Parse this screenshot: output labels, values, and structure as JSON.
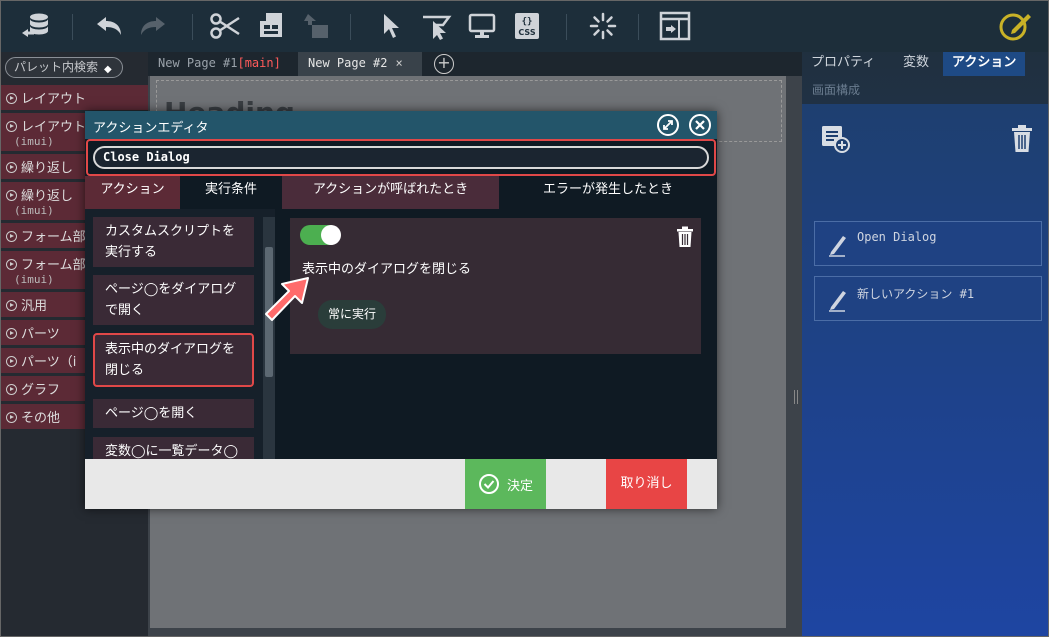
{
  "toolbar": {
    "icons": [
      "database-icon",
      "undo-icon",
      "redo-icon",
      "cut-icon",
      "copy-icon",
      "paste-icon",
      "select-icon",
      "select-parent-icon",
      "preview-icon",
      "css-icon",
      "loading-icon",
      "window-icon",
      "edit-mode-icon"
    ],
    "css_label": "CSS",
    "css_braces": "{}"
  },
  "palette": {
    "search_placeholder": "パレット内検索",
    "items": [
      {
        "label": "レイアウト",
        "sub": ""
      },
      {
        "label": "レイアウト",
        "sub": "(imui)"
      },
      {
        "label": "繰り返し",
        "sub": ""
      },
      {
        "label": "繰り返し",
        "sub": "(imui)"
      },
      {
        "label": "フォーム部",
        "sub": ""
      },
      {
        "label": "フォーム部",
        "sub": "(imui)"
      },
      {
        "label": "汎用",
        "sub": ""
      },
      {
        "label": "パーツ",
        "sub": ""
      },
      {
        "label": "パーツ（i",
        "sub": ""
      },
      {
        "label": "グラフ",
        "sub": ""
      },
      {
        "label": "その他",
        "sub": ""
      }
    ]
  },
  "page_tabs": {
    "tab1": {
      "label": "New Page #1",
      "badge": "[main]"
    },
    "tab2": {
      "label": "New Page #2",
      "close": "×"
    },
    "add": "+"
  },
  "canvas": {
    "heading": "Heading"
  },
  "right_panel": {
    "tabs": [
      "プロパティ",
      "変数",
      "アクション"
    ],
    "active_tab": "アクション",
    "subtitle": "画面構成",
    "actions": [
      "Open Dialog",
      "新しいアクション #1"
    ]
  },
  "dialog": {
    "title": "アクションエディタ",
    "name_value": "Close Dialog",
    "tabs": [
      {
        "label": "アクション",
        "bg": "#5c2a36"
      },
      {
        "label": "実行条件",
        "bg": "#0f1a23"
      },
      {
        "label": "アクションが呼ばれたとき",
        "bg": "#4a2c3a"
      },
      {
        "label": "エラーが発生したとき",
        "bg": "#0f1a23"
      }
    ],
    "action_list": [
      {
        "line1": "カスタムスクリプトを",
        "line2": "実行する"
      },
      {
        "line1": "ページ◯をダイアログ",
        "line2": "で開く"
      },
      {
        "line1": "表示中のダイアログを",
        "line2": "閉じる"
      },
      {
        "line1": "ページ◯を開く",
        "line2": ""
      },
      {
        "line1": "変数◯に一覧データ◯",
        "line2": ""
      }
    ],
    "card": {
      "enabled": true,
      "text": "表示中のダイアログを閉じる",
      "chip": "常に実行"
    },
    "ok_label": "決定",
    "cancel_label": "取り消し"
  },
  "colors": {
    "accent_red": "#e04848",
    "ok_green": "#5cb85c",
    "cancel_red": "#e84545"
  }
}
